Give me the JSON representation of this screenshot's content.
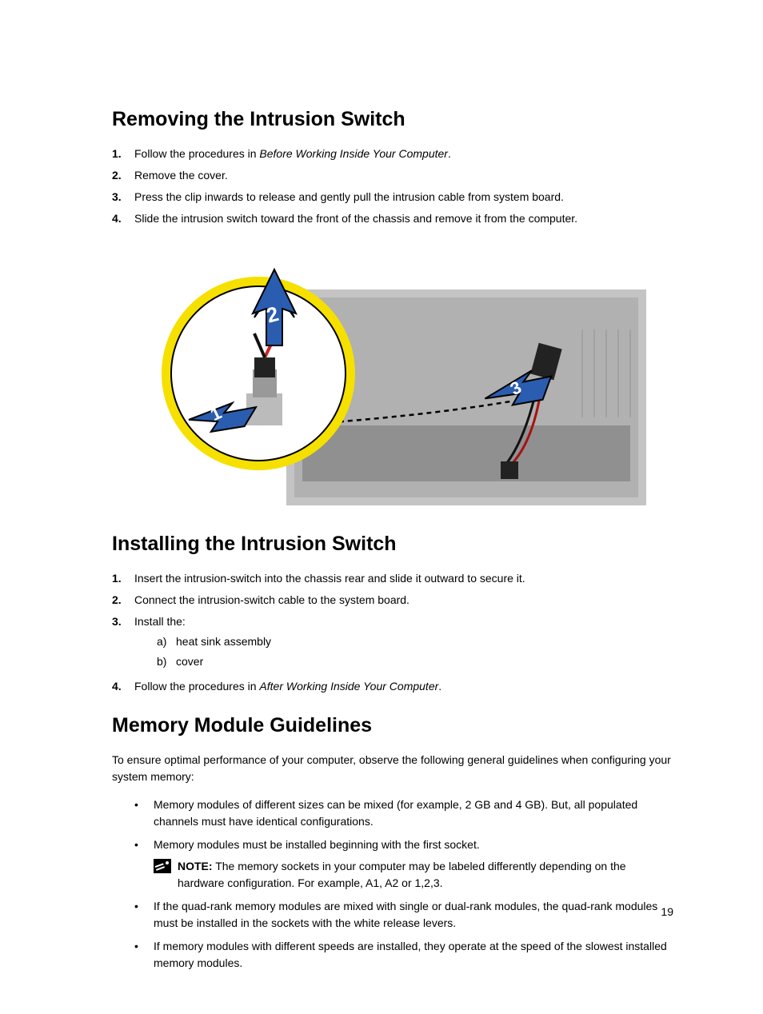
{
  "section1": {
    "heading": "Removing the Intrusion Switch",
    "steps": [
      {
        "num": "1.",
        "pre": "Follow the procedures in ",
        "italic": "Before Working Inside Your Computer",
        "post": "."
      },
      {
        "num": "2.",
        "text": "Remove the cover."
      },
      {
        "num": "3.",
        "text": "Press the clip inwards to release and gently pull the intrusion cable from system board."
      },
      {
        "num": "4.",
        "text": "Slide the intrusion switch toward the front of the chassis and remove it from the computer."
      }
    ]
  },
  "figure": {
    "labels": [
      "1",
      "2",
      "3"
    ]
  },
  "section2": {
    "heading": "Installing the Intrusion Switch",
    "steps": [
      {
        "num": "1.",
        "text": "Insert the intrusion-switch into the chassis rear and slide it outward to secure it."
      },
      {
        "num": "2.",
        "text": "Connect the intrusion-switch cable to the system board."
      },
      {
        "num": "3.",
        "text": "Install the:",
        "sub": [
          {
            "lbl": "a)",
            "text": "heat sink assembly"
          },
          {
            "lbl": "b)",
            "text": "cover"
          }
        ]
      },
      {
        "num": "4.",
        "pre": "Follow the procedures in ",
        "italic": "After Working Inside Your Computer",
        "post": "."
      }
    ]
  },
  "section3": {
    "heading": "Memory Module Guidelines",
    "intro": "To ensure optimal performance of your computer, observe the following general guidelines when configuring your system memory:",
    "bullets": [
      {
        "text": "Memory modules of different sizes can be mixed (for example, 2 GB and 4 GB). But, all populated channels must have identical configurations."
      },
      {
        "text": "Memory modules must be installed beginning with the first socket.",
        "note": {
          "bold": "NOTE:",
          "rest": " The memory sockets in your computer may be labeled differently depending on the hardware configuration. For example, A1, A2 or 1,2,3."
        }
      },
      {
        "text": "If the quad-rank memory modules are mixed with single or dual-rank modules, the quad-rank modules must be installed in the sockets with the white release levers."
      },
      {
        "text": "If memory modules with different speeds are installed, they operate at the speed of the slowest installed memory modules."
      }
    ]
  },
  "pagenum": "19"
}
